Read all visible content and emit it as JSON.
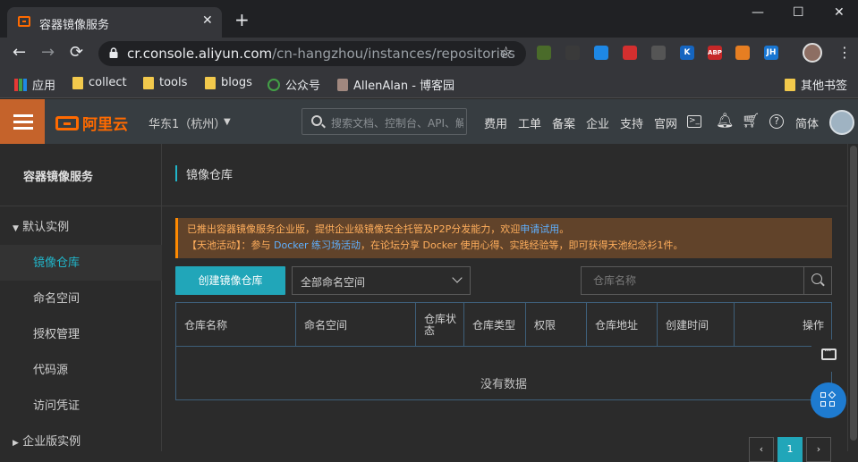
{
  "browser": {
    "tab_title": "容器镜像服务",
    "tab_close": "✕",
    "new_tab": "+",
    "window_controls": {
      "minimize": "—",
      "maximize": "☐",
      "close": "✕"
    },
    "nav": {
      "back": "←",
      "forward": "→",
      "reload": "⟳"
    },
    "url_host": "cr.console.aliyun.com",
    "url_path": "/cn-hangzhou/instances/repositories",
    "extensions": [
      {
        "icon": "leaf-extension-icon",
        "text": "",
        "color": "#4a6b2a"
      },
      {
        "icon": "owl-extension-icon",
        "text": "",
        "color": "#3a3a3a"
      },
      {
        "icon": "pocket-extension-icon",
        "text": "",
        "color": "#1e88e5"
      },
      {
        "icon": "red-square-extension-icon",
        "text": "",
        "color": "#d32f2f"
      },
      {
        "icon": "gauge-extension-icon",
        "text": "",
        "color": "#555555"
      },
      {
        "icon": "k-extension-icon",
        "text": "K",
        "color": "#1565c0"
      },
      {
        "icon": "abp-extension-icon",
        "text": "ABP",
        "color": "#c62828"
      },
      {
        "icon": "puzzle-extension-icon",
        "text": "",
        "color": "#e67e22"
      },
      {
        "icon": "jh-extension-icon",
        "text": "JH",
        "color": "#1976d2"
      }
    ],
    "bookmarks": [
      {
        "label": "应用",
        "icon": "apps-grid-icon"
      },
      {
        "label": "collect",
        "icon": "folder-icon"
      },
      {
        "label": "tools",
        "icon": "folder-icon"
      },
      {
        "label": "blogs",
        "icon": "folder-icon"
      },
      {
        "label": "公众号",
        "icon": "wechat-icon"
      },
      {
        "label": "AllenAlan - 博客园",
        "icon": "cnblogs-icon"
      }
    ],
    "other_bookmarks": "其他书签"
  },
  "header": {
    "logo_text": "阿里云",
    "region": "华东1（杭州）",
    "search_placeholder": "搜索文档、控制台、API、解决方案和资源",
    "nav": [
      "费用",
      "工单",
      "备案",
      "企业",
      "支持",
      "官网"
    ],
    "lang": "简体"
  },
  "sidebar": {
    "title": "容器镜像服务",
    "group_default": "默认实例",
    "items": [
      "镜像仓库",
      "命名空间",
      "授权管理",
      "代码源",
      "访问凭证"
    ],
    "group_enterprise": "企业版实例"
  },
  "main": {
    "page_title": "镜像仓库",
    "notice_line1_prefix": "已推出容器镜像服务企业版，提供企业级镜像安全托管及P2P分发能力，欢迎",
    "notice_line1_link": "申请试用",
    "notice_line1_suffix": "。",
    "notice_line2_prefix": "【天池活动】：参与 ",
    "notice_line2_link": "Docker 练习场活动",
    "notice_line2_suffix": "，在论坛分享 Docker 使用心得、实践经验等，即可获得天池纪念衫1件。",
    "create_button": "创建镜像仓库",
    "namespace_select": "全部命名空间",
    "repo_search_placeholder": "仓库名称",
    "table_headers": [
      "仓库名称",
      "命名空间",
      "仓库状态",
      "仓库类型",
      "权限",
      "仓库地址",
      "创建时间",
      "操作"
    ],
    "empty_text": "没有数据",
    "pagination": {
      "prev": "‹",
      "current": "1",
      "next": "›"
    }
  },
  "colors": {
    "accent": "#21a6b9",
    "brand": "#ff6a00",
    "menu_button": "#c5632b",
    "notice_bg": "#61432a",
    "notice_text": "#ffae5c"
  }
}
